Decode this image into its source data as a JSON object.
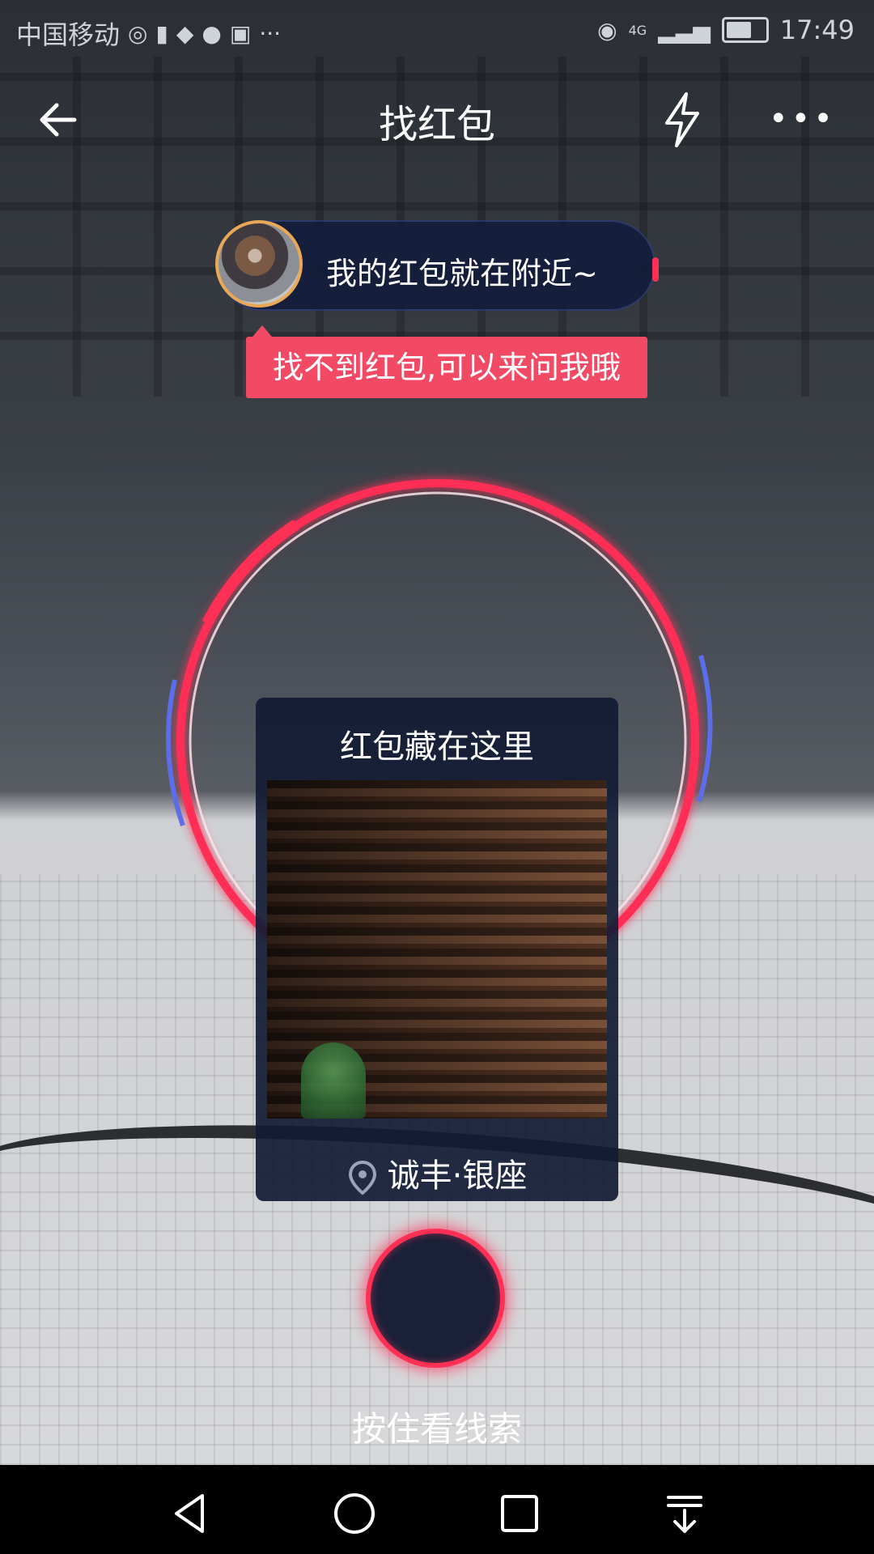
{
  "status_bar": {
    "carrier": "中国移动",
    "network": "4G",
    "time": "17:49"
  },
  "nav": {
    "title": "找红包"
  },
  "bubble": {
    "message": "我的红包就在附近~"
  },
  "hint": {
    "text": "找不到红包,可以来问我哦"
  },
  "card": {
    "title": "红包藏在这里",
    "location": "诚丰·银座"
  },
  "hold_button": {
    "label": "按住看线索"
  },
  "colors": {
    "accent": "#ff2f56",
    "hint_bg": "#f24a65",
    "card_bg": "#121b34",
    "ring_blue": "#5b6ee8"
  },
  "icons": {
    "back": "arrow-left-icon",
    "flash": "lightning-icon",
    "more": "more-dots-icon",
    "location": "location-pin-icon",
    "nav_back": "triangle-back-icon",
    "nav_home": "circle-home-icon",
    "nav_recent": "square-recent-icon",
    "nav_notifications": "pull-down-icon"
  }
}
